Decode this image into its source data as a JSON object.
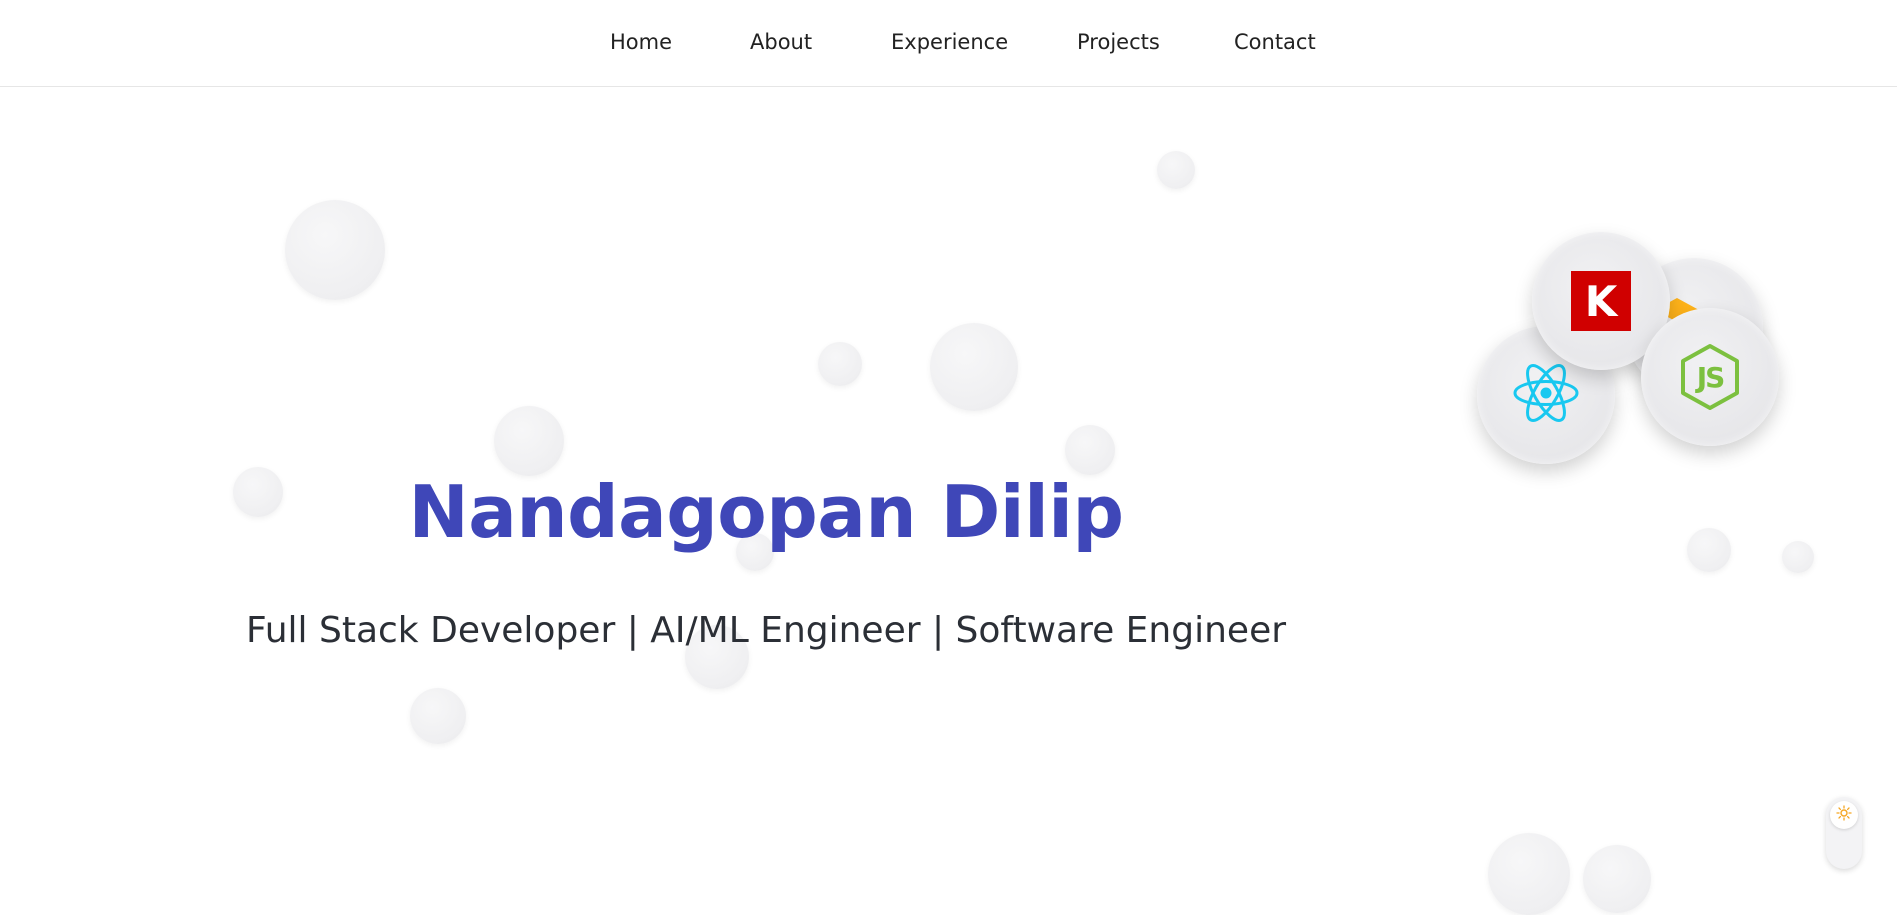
{
  "nav": {
    "items": [
      {
        "label": "Home"
      },
      {
        "label": "About"
      },
      {
        "label": "Experience"
      },
      {
        "label": "Projects"
      },
      {
        "label": "Contact"
      }
    ]
  },
  "hero": {
    "name": "Nandagopan Dilip",
    "subtitle": "Full Stack Developer | AI/ML Engineer | Software Engineer"
  },
  "tech_icons": {
    "keras": {
      "letter": "K",
      "icon": "keras-icon",
      "color": "#d00000"
    },
    "tensorflow": {
      "icon": "tensorflow-icon",
      "color": "#ffa800"
    },
    "react": {
      "icon": "react-icon",
      "color": "#18c8f0"
    },
    "nodejs": {
      "letters": "JS",
      "icon": "nodejs-icon",
      "color": "#7cc03f"
    }
  },
  "theme_toggle": {
    "icon": "sun-icon",
    "color": "#f5a623"
  },
  "colors": {
    "accent": "#3f47b8",
    "text": "#2b2f36"
  }
}
